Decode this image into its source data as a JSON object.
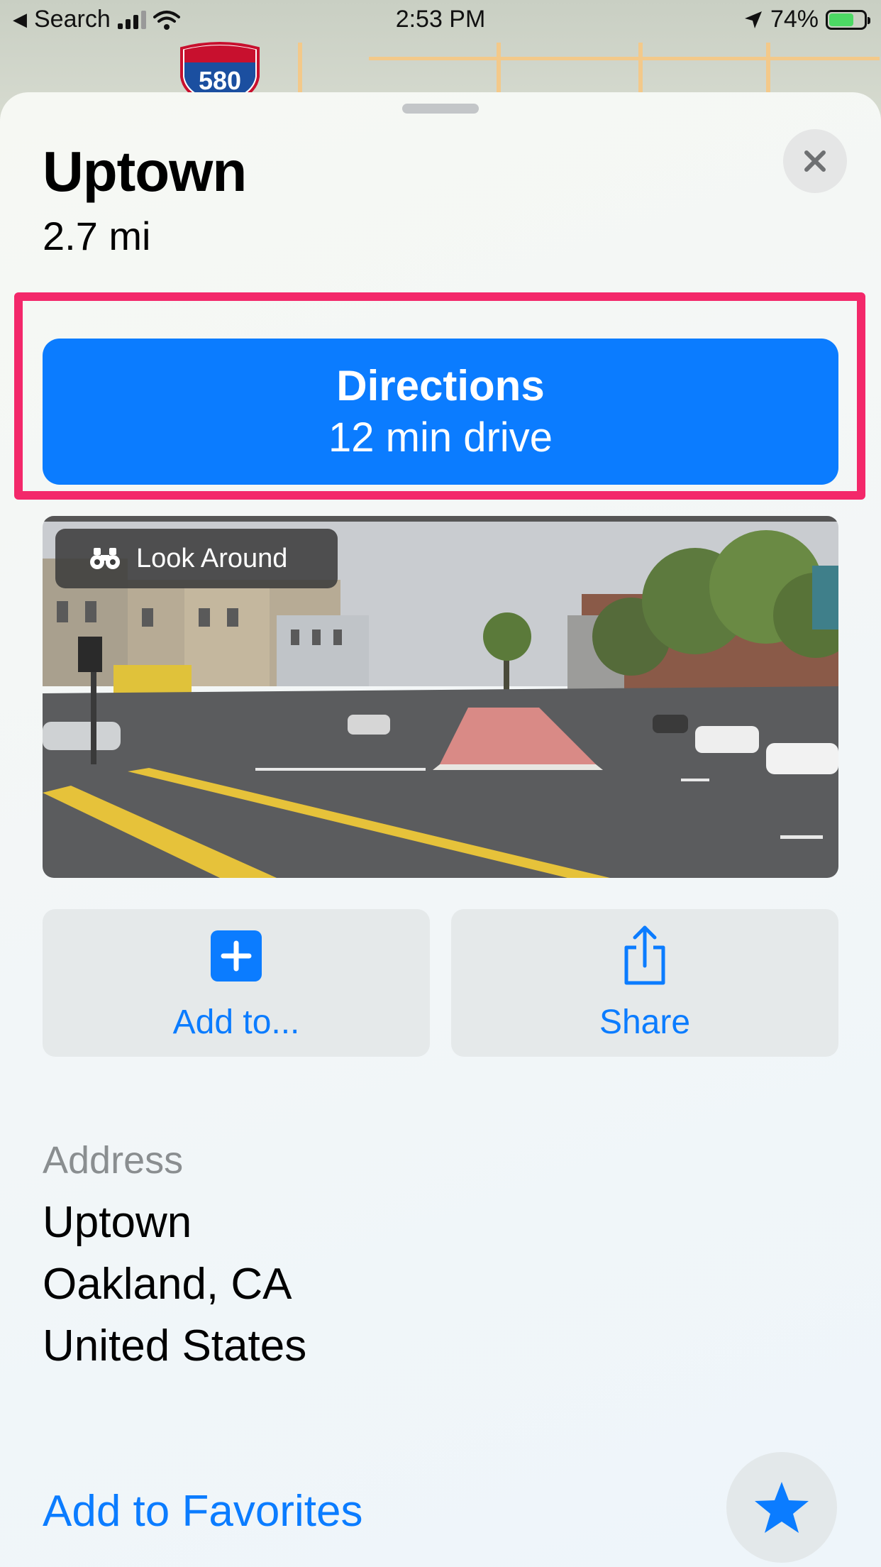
{
  "status_bar": {
    "back_app": "Search",
    "time": "2:53 PM",
    "battery": "74%",
    "battery_level": 0.74
  },
  "map": {
    "highway_shield": "580"
  },
  "place": {
    "title": "Uptown",
    "distance": "2.7 mi"
  },
  "directions": {
    "label": "Directions",
    "eta": "12 min drive"
  },
  "look_around": {
    "label": "Look Around"
  },
  "actions": {
    "add_label": "Add to...",
    "share_label": "Share"
  },
  "address": {
    "heading": "Address",
    "lines": [
      "Uptown",
      "Oakland, CA",
      "United States"
    ]
  },
  "favorites": {
    "label": "Add to Favorites"
  },
  "colors": {
    "accent": "#0b7cff",
    "highlight": "#f3286a"
  },
  "icons": {
    "close": "close-icon",
    "look_around": "binoculars-icon",
    "add": "plus-square-icon",
    "share": "share-icon",
    "favorite": "star-icon"
  }
}
